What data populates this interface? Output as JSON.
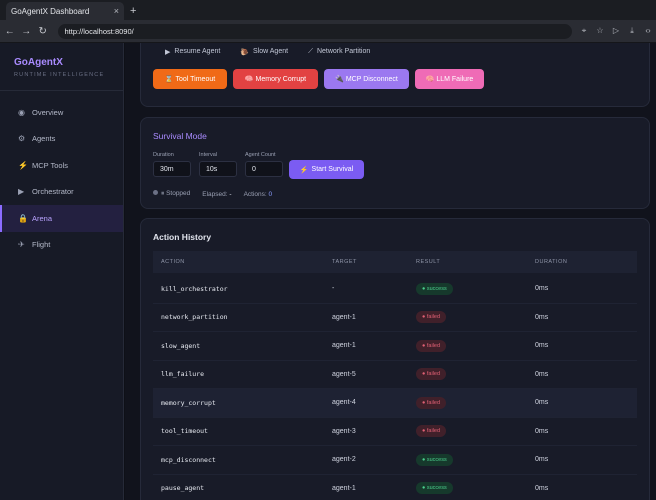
{
  "browser": {
    "tab_title": "GoAgentX Dashboard",
    "tab_close": "×",
    "new_tab": "+",
    "url": "http://localhost:8090/"
  },
  "sidebar": {
    "brand": "GoAgentX",
    "subtitle": "RUNTIME INTELLIGENCE",
    "items": [
      {
        "label": "Overview",
        "icon": "◉"
      },
      {
        "label": "Agents",
        "icon": "⚙"
      },
      {
        "label": "MCP Tools",
        "icon": "⚡"
      },
      {
        "label": "Orchestrator",
        "icon": "▶"
      },
      {
        "label": "Arena",
        "icon": "🔒"
      },
      {
        "label": "Flight",
        "icon": "✈"
      }
    ],
    "active": "Arena"
  },
  "chaos": {
    "links": [
      {
        "icon": "▶",
        "label": "Resume Agent"
      },
      {
        "icon": "🐌",
        "label": "Slow Agent"
      },
      {
        "icon": "⟋",
        "label": "Network Partition"
      }
    ],
    "buttons": [
      {
        "icon": "⌛",
        "label": "Tool Timeout",
        "color": "#f06a17"
      },
      {
        "icon": "🧠",
        "label": "Memory Corrupt",
        "color": "#e24242"
      },
      {
        "icon": "🔌",
        "label": "MCP Disconnect",
        "color": "#9b78f0"
      },
      {
        "icon": "🧠",
        "label": "LLM Failure",
        "color": "#ef6bb6"
      }
    ]
  },
  "survival": {
    "title": "Survival Mode",
    "duration_label": "Duration",
    "duration_value": "30m",
    "interval_label": "Interval",
    "interval_value": "10s",
    "agent_count_label": "Agent Count",
    "agent_count_value": "0",
    "start_label": "Start Survival",
    "start_icon": "⚡",
    "status": "Stopped",
    "status_icon": "⏸",
    "elapsed_label": "Elapsed:",
    "elapsed_value": "-",
    "actions_label": "Actions:",
    "actions_value": "0"
  },
  "history": {
    "title": "Action History",
    "columns": [
      "ACTION",
      "TARGET",
      "RESULT",
      "DURATION"
    ],
    "rows": [
      {
        "action": "kill_orchestrator",
        "target": "-",
        "result": "success",
        "duration": "0ms"
      },
      {
        "action": "network_partition",
        "target": "agent-1",
        "result": "failed",
        "duration": "0ms"
      },
      {
        "action": "slow_agent",
        "target": "agent-1",
        "result": "failed",
        "duration": "0ms"
      },
      {
        "action": "llm_failure",
        "target": "agent-5",
        "result": "failed",
        "duration": "0ms"
      },
      {
        "action": "memory_corrupt",
        "target": "agent-4",
        "result": "failed",
        "duration": "0ms"
      },
      {
        "action": "tool_timeout",
        "target": "agent-3",
        "result": "failed",
        "duration": "0ms"
      },
      {
        "action": "mcp_disconnect",
        "target": "agent-2",
        "result": "success",
        "duration": "0ms"
      },
      {
        "action": "pause_agent",
        "target": "agent-1",
        "result": "success",
        "duration": "0ms"
      }
    ]
  },
  "colors": {
    "accent": "#8b6cff",
    "success": "#4bd08d",
    "failed": "#e06074"
  }
}
